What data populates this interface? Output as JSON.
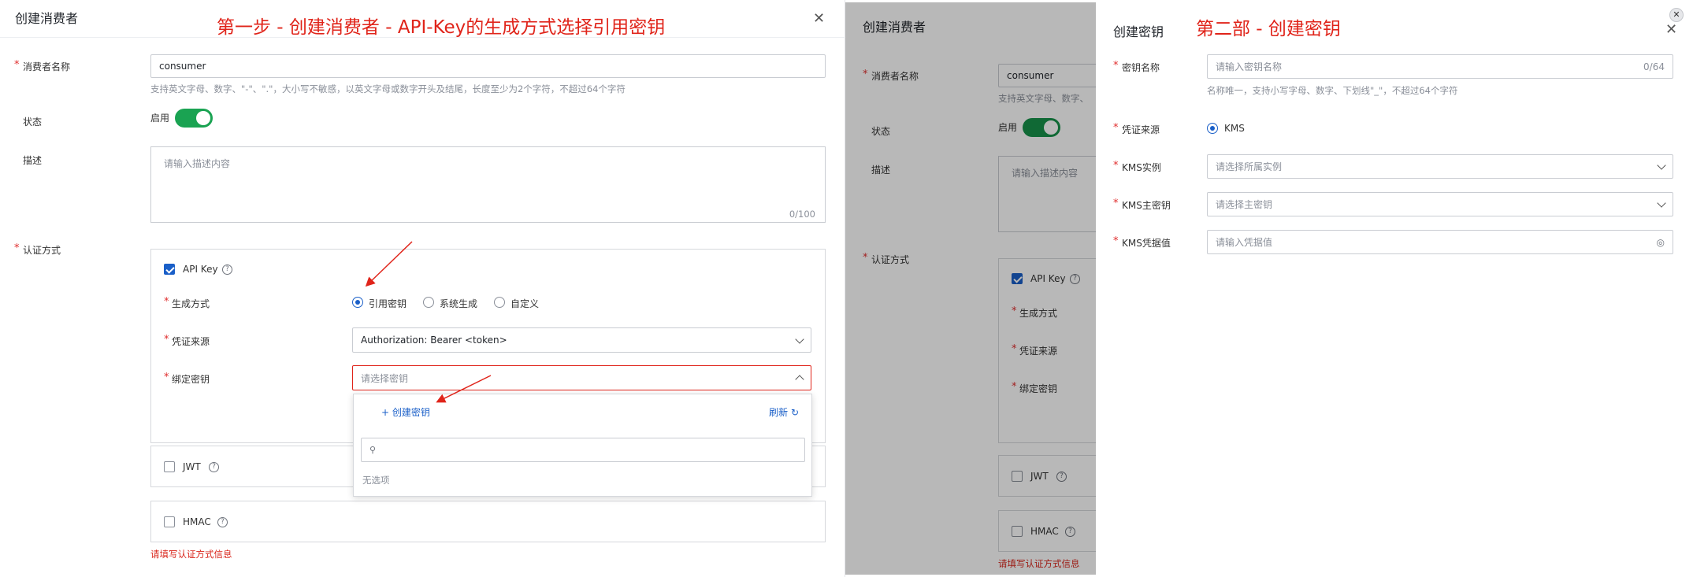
{
  "left": {
    "title": "创建消费者",
    "annotation": "第一步 - 创建消费者 - API-Key的生成方式选择引用密钥",
    "consumer_name": {
      "label": "消费者名称",
      "value": "consumer",
      "hint": "支持英文字母、数字、\"-\"、\".\"，大小写不敏感，以英文字母或数字开头及结尾，长度至少为2个字符，不超过64个字符"
    },
    "status": {
      "label": "状态",
      "toggle_label": "启用"
    },
    "description": {
      "label": "描述",
      "placeholder": "请输入描述内容",
      "counter": "0/100"
    },
    "auth": {
      "label": "认证方式",
      "api_key_label": "API Key",
      "gen_method": {
        "label": "生成方式",
        "options": [
          "引用密钥",
          "系统生成",
          "自定义"
        ],
        "selected": "引用密钥"
      },
      "credential_source": {
        "label": "凭证来源",
        "value": "Authorization: Bearer <token>"
      },
      "bind_key": {
        "label": "绑定密钥",
        "placeholder": "请选择密钥"
      },
      "dropdown": {
        "create_label": "+ 创建密钥",
        "refresh_label": "刷新",
        "empty_text": "无选项"
      },
      "jwt_label": "JWT",
      "hmac_label": "HMAC",
      "error": "请填写认证方式信息"
    }
  },
  "right_bg": {
    "title": "创建消费者",
    "consumer_name": {
      "label": "消费者名称",
      "value": "consumer",
      "hint": "支持英文字母、数字、"
    },
    "status": {
      "label": "状态",
      "toggle_label": "启用"
    },
    "description": {
      "label": "描述",
      "placeholder": "请输入描述内容"
    },
    "auth": {
      "label": "认证方式",
      "api_key_label": "API Key",
      "gen_label": "生成方式",
      "source_label": "凭证来源",
      "bind_label": "绑定密钥",
      "jwt_label": "JWT",
      "hmac_label": "HMAC",
      "error": "请填写认证方式信息"
    }
  },
  "drawer": {
    "title": "创建密钥",
    "annotation": "第二部 - 创建密钥",
    "key_name": {
      "label": "密钥名称",
      "placeholder": "请输入密钥名称",
      "counter": "0/64",
      "hint": "名称唯一，支持小写字母、数字、下划线\"_\"，不超过64个字符"
    },
    "credential_source": {
      "label": "凭证来源",
      "option": "KMS"
    },
    "kms_instance": {
      "label": "KMS实例",
      "placeholder": "请选择所属实例"
    },
    "kms_master_key": {
      "label": "KMS主密钥",
      "placeholder": "请选择主密钥"
    },
    "kms_credential": {
      "label": "KMS凭据值",
      "placeholder": "请输入凭据值"
    }
  },
  "colors": {
    "accent": "#1a5fc8",
    "annotation": "#e0241a",
    "toggle_on": "#1aa352",
    "error": "#d9241a"
  }
}
